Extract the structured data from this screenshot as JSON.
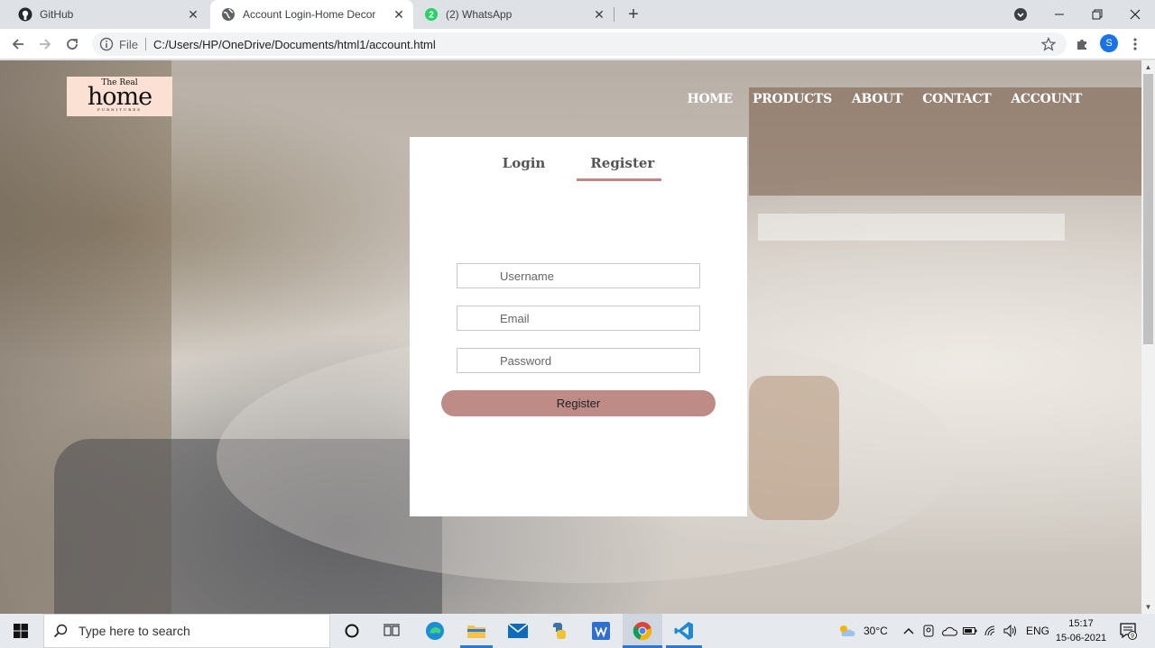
{
  "browser": {
    "tabs": [
      {
        "title": "GitHub",
        "icon": "github-icon",
        "active": false
      },
      {
        "title": "Account Login-Home Decor",
        "icon": "globe-icon",
        "active": true
      },
      {
        "title": "(2) WhatsApp",
        "icon": "whatsapp-icon",
        "badge": "2",
        "active": false
      }
    ],
    "address": {
      "scheme_label": "File",
      "url": "C:/Users/HP/OneDrive/Documents/html1/account.html"
    },
    "profile_initial": "S"
  },
  "site": {
    "logo": {
      "top": "The Real",
      "main": "home",
      "sub": "FURNITURES"
    },
    "nav": [
      "HOME",
      "PRODUCTS",
      "ABOUT",
      "CONTACT",
      "ACCOUNT"
    ],
    "form": {
      "tab_login": "Login",
      "tab_register": "Register",
      "username_placeholder": "Username",
      "email_placeholder": "Email",
      "password_placeholder": "Password",
      "submit_label": "Register"
    }
  },
  "taskbar": {
    "search_placeholder": "Type here to search",
    "weather": "30°C",
    "language": "ENG",
    "time": "15:17",
    "date": "15-06-2021",
    "notification_count": "9"
  },
  "colors": {
    "accent": "#c08686",
    "button": "#be8b86",
    "logo_bg": "#fbe1d3"
  }
}
